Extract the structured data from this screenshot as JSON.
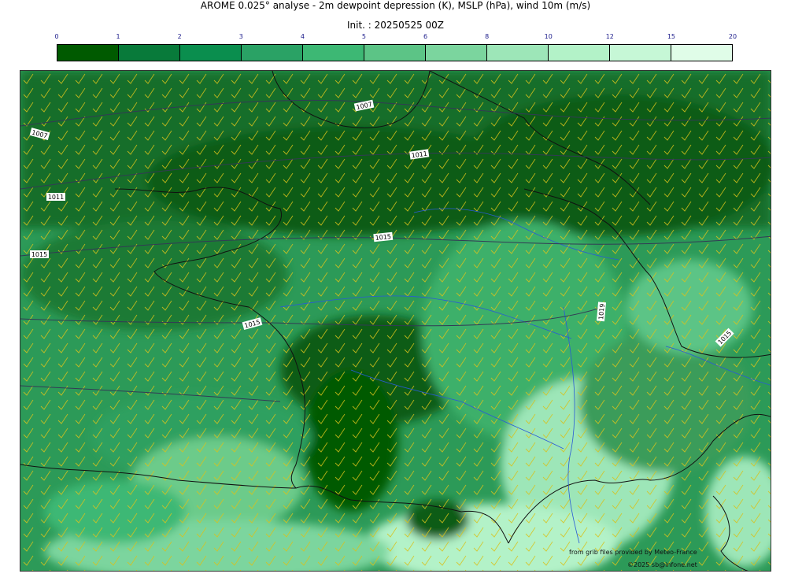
{
  "header": {
    "title": "AROME 0.025° analyse - 2m dewpoint depression (K), MSLP (hPa), wind 10m (m/s)",
    "init": "Init. : 20250525 00Z"
  },
  "colorbar": {
    "ticks": [
      "0",
      "1",
      "2",
      "3",
      "4",
      "5",
      "6",
      "8",
      "10",
      "12",
      "15",
      "20"
    ],
    "colors": [
      "#005a00",
      "#087a3a",
      "#0a8e4e",
      "#2aa265",
      "#3db874",
      "#5cc486",
      "#7bd59e",
      "#9de6b8",
      "#b3f2c8",
      "#c6f7d6",
      "#e0fde8"
    ]
  },
  "map": {
    "isobar_labels": [
      "1007",
      "1007",
      "1011",
      "1011",
      "1015",
      "1015",
      "1015",
      "1015",
      "1019",
      "1015"
    ],
    "credits": {
      "source": "from grib files provided by Meteo-France",
      "copyright": "©2025 sb@infone.net"
    }
  }
}
